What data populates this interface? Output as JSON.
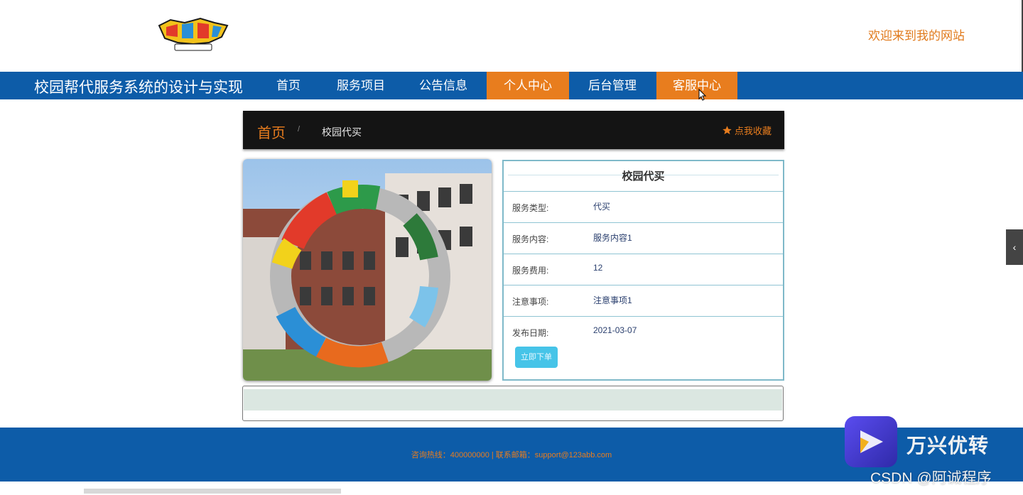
{
  "header": {
    "welcome": "欢迎来到我的网站"
  },
  "nav": {
    "site_title": "校园帮代服务系统的设计与实现",
    "items": [
      {
        "label": "首页"
      },
      {
        "label": "服务项目"
      },
      {
        "label": "公告信息"
      },
      {
        "label": "个人中心"
      },
      {
        "label": "后台管理"
      },
      {
        "label": "客服中心"
      }
    ]
  },
  "breadcrumb": {
    "home": "首页",
    "separator": "/",
    "current": "校园代买",
    "favorite": "点我收藏"
  },
  "detail": {
    "title": "校园代买",
    "rows": [
      {
        "label": "服务类型:",
        "value": "代买"
      },
      {
        "label": "服务内容:",
        "value": "服务内容1"
      },
      {
        "label": "服务费用:",
        "value": "12"
      },
      {
        "label": "注意事项:",
        "value": "注意事项1"
      },
      {
        "label": "发布日期:",
        "value": "2021-03-07"
      }
    ],
    "order_button": "立即下单"
  },
  "footer": {
    "text": "咨询热线：400000000 | 联系邮箱：support@123abb.com"
  },
  "watermark": {
    "app_name": "万兴优转",
    "credit": "CSDN @阿诚程序"
  },
  "colors": {
    "nav_blue": "#0d5ca8",
    "accent_orange": "#e87d1e",
    "panel_border": "#7fb9c9",
    "button_blue": "#46c4e8"
  }
}
